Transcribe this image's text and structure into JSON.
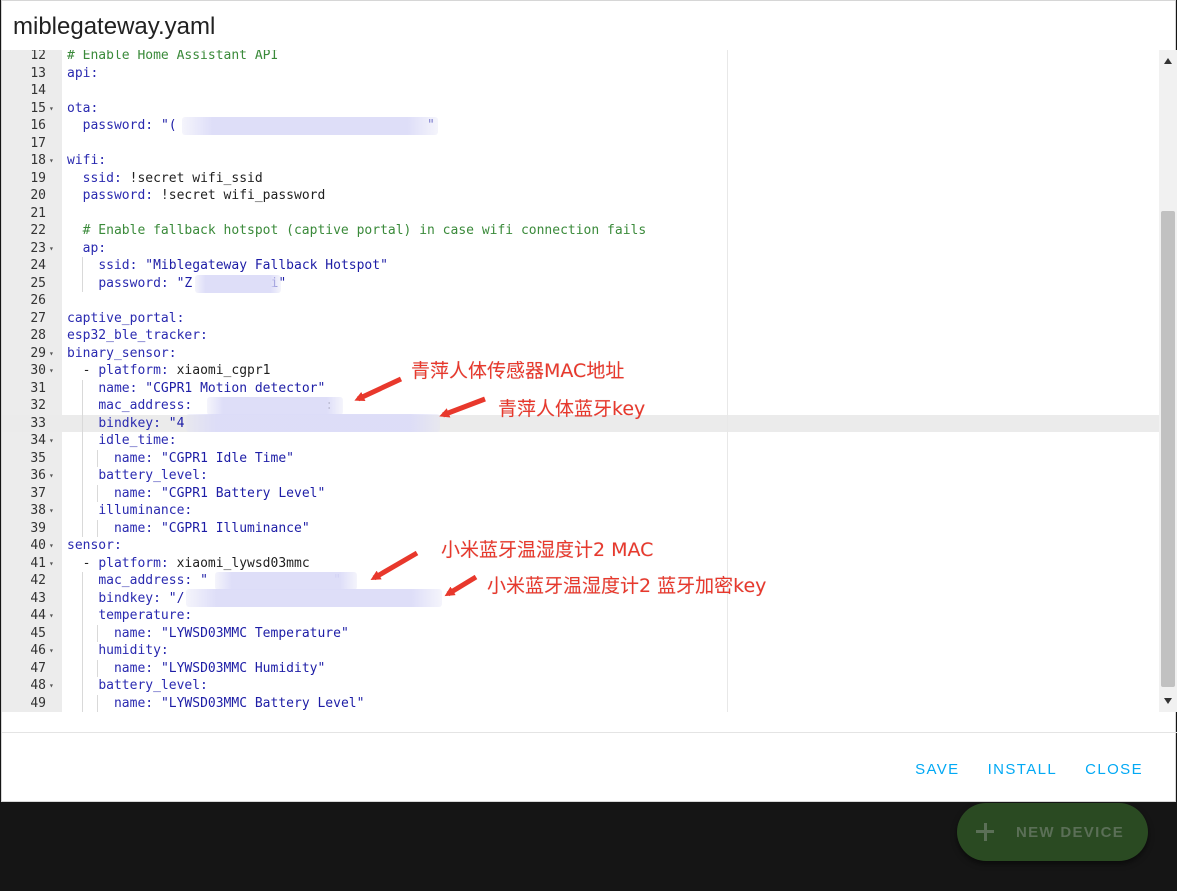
{
  "dialog": {
    "title": "miblegateway.yaml",
    "actions": {
      "save": "SAVE",
      "install": "INSTALL",
      "close": "CLOSE"
    }
  },
  "fab": {
    "label": "NEW DEVICE",
    "icon": "plus-icon"
  },
  "editor": {
    "active_line": 33,
    "lines": [
      {
        "n": 12,
        "fold": false,
        "text": "# Enable Home Assistant API"
      },
      {
        "n": 13,
        "fold": false,
        "text": "api:"
      },
      {
        "n": 14,
        "fold": false,
        "text": ""
      },
      {
        "n": 15,
        "fold": true,
        "text": "ota:"
      },
      {
        "n": 16,
        "fold": false,
        "text": "  password: \"(                                \""
      },
      {
        "n": 17,
        "fold": false,
        "text": ""
      },
      {
        "n": 18,
        "fold": true,
        "text": "wifi:"
      },
      {
        "n": 19,
        "fold": false,
        "text": "  ssid: !secret wifi_ssid"
      },
      {
        "n": 20,
        "fold": false,
        "text": "  password: !secret wifi_password"
      },
      {
        "n": 21,
        "fold": false,
        "text": ""
      },
      {
        "n": 22,
        "fold": false,
        "text": "  # Enable fallback hotspot (captive portal) in case wifi connection fails"
      },
      {
        "n": 23,
        "fold": true,
        "text": "  ap:"
      },
      {
        "n": 24,
        "fold": false,
        "text": "    ssid: \"Miblegateway Fallback Hotspot\""
      },
      {
        "n": 25,
        "fold": false,
        "text": "    password: \"Z          i\""
      },
      {
        "n": 26,
        "fold": false,
        "text": ""
      },
      {
        "n": 27,
        "fold": false,
        "text": "captive_portal:"
      },
      {
        "n": 28,
        "fold": false,
        "text": "esp32_ble_tracker:"
      },
      {
        "n": 29,
        "fold": true,
        "text": "binary_sensor:"
      },
      {
        "n": 30,
        "fold": true,
        "text": "  - platform: xiaomi_cgpr1"
      },
      {
        "n": 31,
        "fold": false,
        "text": "    name: \"CGPR1 Motion detector\""
      },
      {
        "n": 32,
        "fold": false,
        "text": "    mac_address:                 :"
      },
      {
        "n": 33,
        "fold": false,
        "text": "    bindkey: \"4"
      },
      {
        "n": 34,
        "fold": true,
        "text": "    idle_time:"
      },
      {
        "n": 35,
        "fold": false,
        "text": "      name: \"CGPR1 Idle Time\""
      },
      {
        "n": 36,
        "fold": true,
        "text": "    battery_level:"
      },
      {
        "n": 37,
        "fold": false,
        "text": "      name: \"CGPR1 Battery Level\""
      },
      {
        "n": 38,
        "fold": true,
        "text": "    illuminance:"
      },
      {
        "n": 39,
        "fold": false,
        "text": "      name: \"CGPR1 Illuminance\""
      },
      {
        "n": 40,
        "fold": true,
        "text": "sensor:"
      },
      {
        "n": 41,
        "fold": true,
        "text": "  - platform: xiaomi_lywsd03mmc"
      },
      {
        "n": 42,
        "fold": false,
        "text": "    mac_address: \"                \""
      },
      {
        "n": 43,
        "fold": false,
        "text": "    bindkey: \"/"
      },
      {
        "n": 44,
        "fold": true,
        "text": "    temperature:"
      },
      {
        "n": 45,
        "fold": false,
        "text": "      name: \"LYWSD03MMC Temperature\""
      },
      {
        "n": 46,
        "fold": true,
        "text": "    humidity:"
      },
      {
        "n": 47,
        "fold": false,
        "text": "      name: \"LYWSD03MMC Humidity\""
      },
      {
        "n": 48,
        "fold": true,
        "text": "    battery_level:"
      },
      {
        "n": 49,
        "fold": false,
        "text": "      name: \"LYWSD03MMC Battery Level\""
      }
    ]
  },
  "annotations": {
    "cgpr1_mac": "青萍人体传感器MAC地址",
    "cgpr1_key": "青萍人体蓝牙key",
    "lywsd_mac": "小米蓝牙温湿度计2 MAC",
    "lywsd_key": "小米蓝牙温湿度计2 蓝牙加密key"
  },
  "colors": {
    "accent": "#03a9f4",
    "annotation": "#e8382c",
    "fab": "#2a4a22",
    "comment": "#3a8a3a",
    "string": "#1d1da6"
  }
}
